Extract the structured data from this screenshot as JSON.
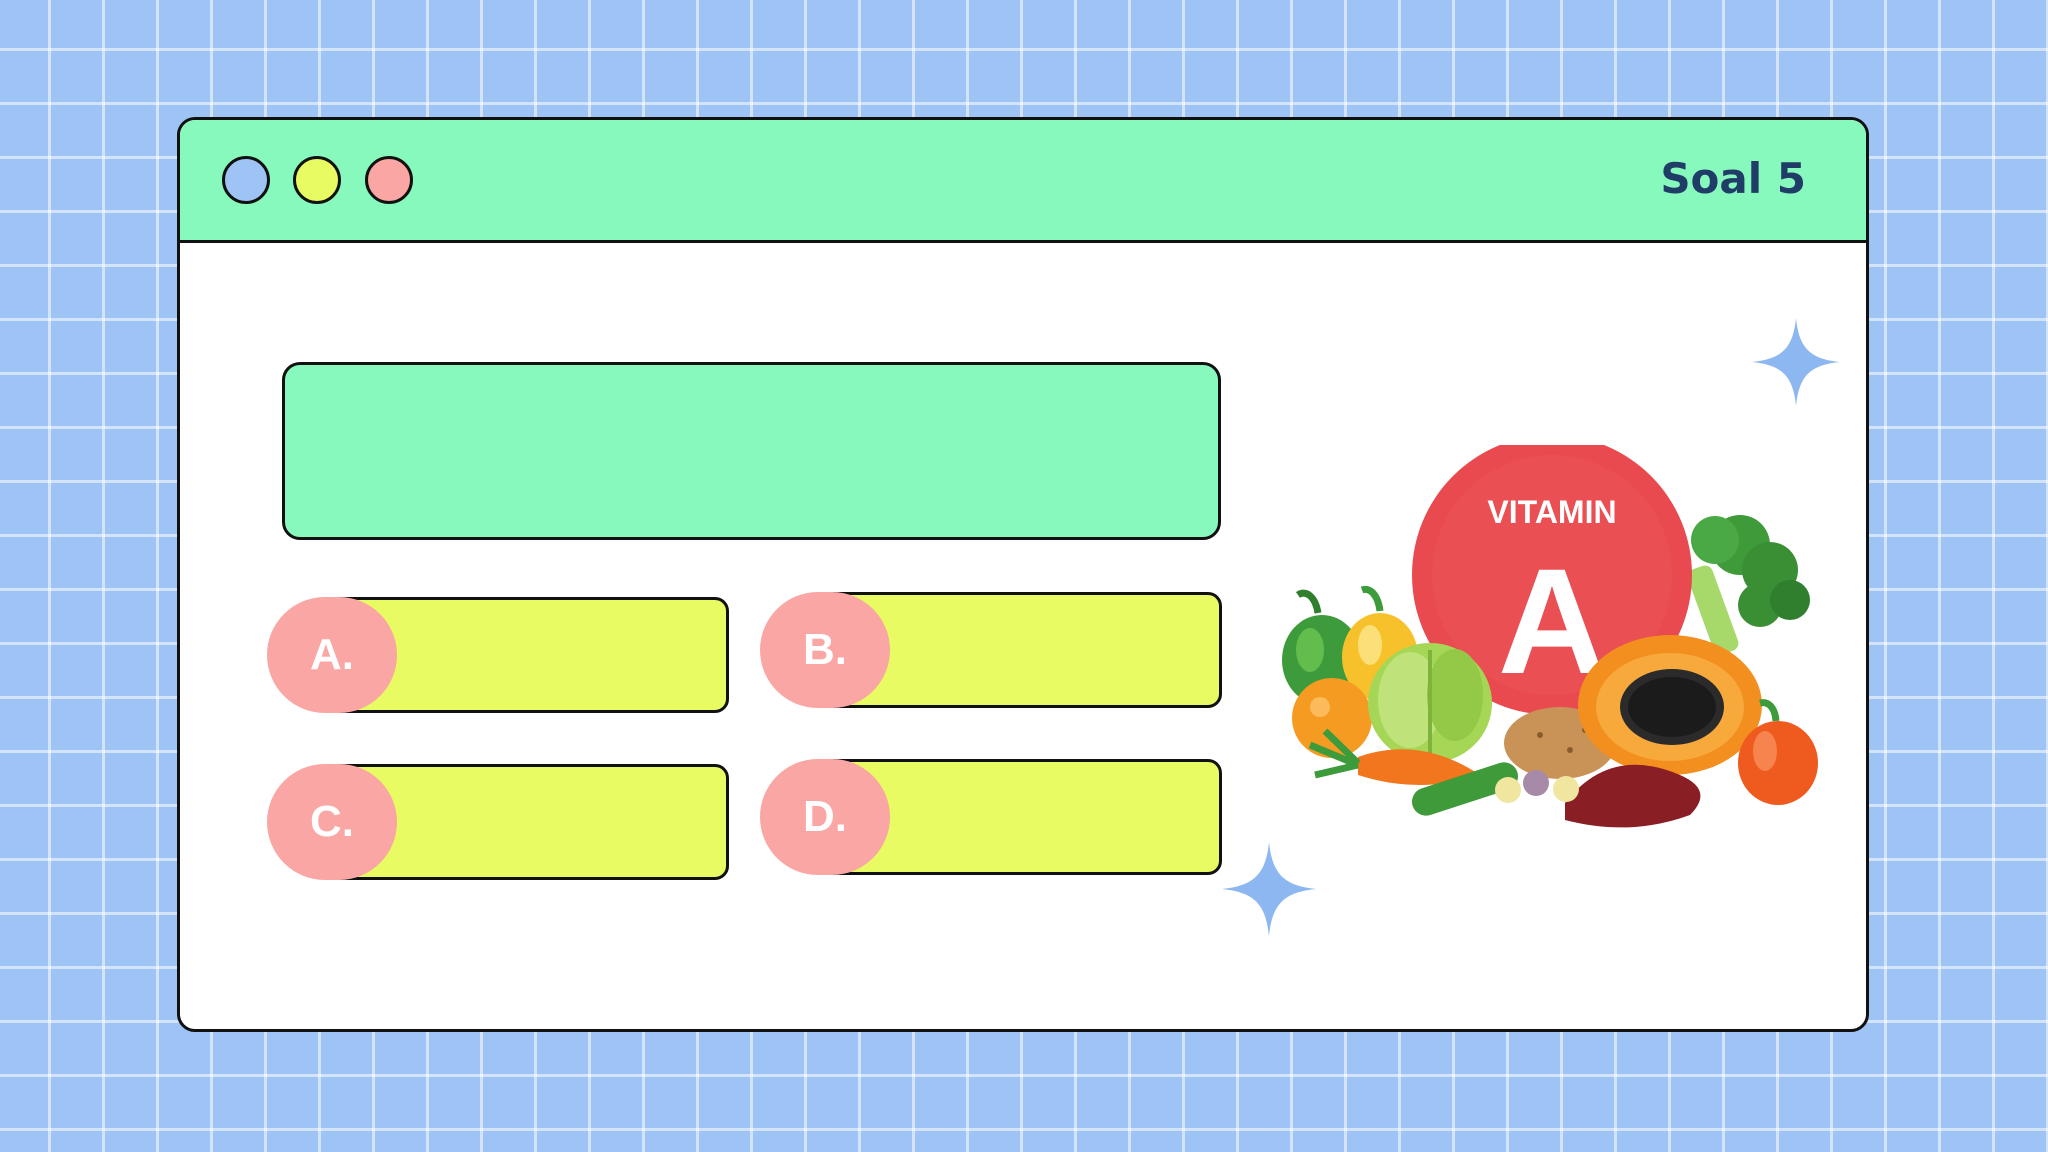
{
  "window": {
    "title": "Soal 5",
    "controls": [
      "blue-dot",
      "yellow-dot",
      "pink-dot"
    ]
  },
  "question": {
    "text": ""
  },
  "answers": [
    {
      "label": "A.",
      "text": ""
    },
    {
      "label": "B.",
      "text": ""
    },
    {
      "label": "C.",
      "text": ""
    },
    {
      "label": "D.",
      "text": ""
    }
  ],
  "illustration": {
    "badge_title": "VITAMIN",
    "badge_letter": "A"
  },
  "colors": {
    "background": "#9ec3f5",
    "titlebar": "#87f9bd",
    "question_box": "#87f9bd",
    "answer_bar": "#e9fb62",
    "answer_badge": "#f9a6a4",
    "dot_blue": "#9ec3f5",
    "dot_yellow": "#e9fb62",
    "dot_pink": "#f9a6a4",
    "title_text": "#1f3d67",
    "vitamin_red": "#e84a4f",
    "sparkle": "#8cb7f0"
  }
}
